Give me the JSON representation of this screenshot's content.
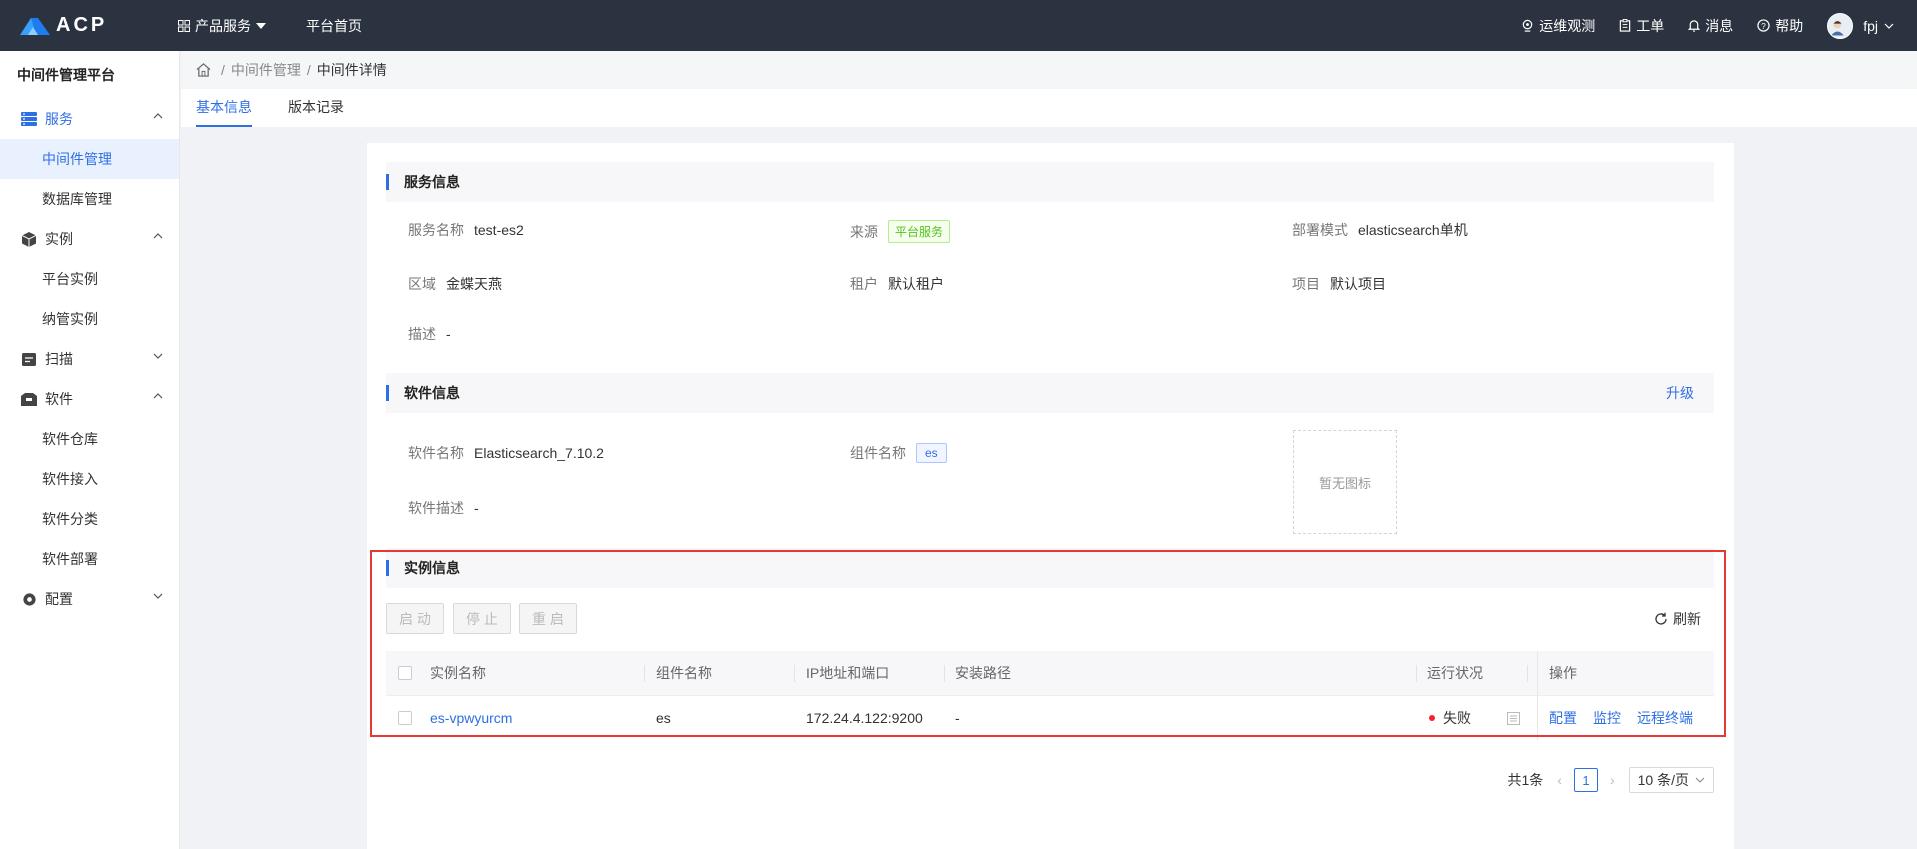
{
  "topbar": {
    "logo_text": "ACP",
    "nav": [
      "产品服务",
      "平台首页"
    ],
    "right": {
      "ops": "运维观测",
      "ticket": "工单",
      "messages": "消息",
      "help": "帮助",
      "user": "fpj"
    }
  },
  "sidebar": {
    "title": "中间件管理平台",
    "groups": [
      {
        "label": "服务",
        "items": [
          "中间件管理",
          "数据库管理"
        ]
      },
      {
        "label": "实例",
        "items": [
          "平台实例",
          "纳管实例"
        ]
      },
      {
        "label": "扫描",
        "items": []
      },
      {
        "label": "软件",
        "items": [
          "软件仓库",
          "软件接入",
          "软件分类",
          "软件部署"
        ]
      },
      {
        "label": "配置",
        "items": []
      }
    ]
  },
  "breadcrumb": {
    "sep": "/",
    "parent": "中间件管理",
    "current": "中间件详情"
  },
  "tabs": [
    "基本信息",
    "版本记录"
  ],
  "service_info": {
    "title": "服务信息",
    "name_label": "服务名称",
    "name": "test-es2",
    "source_label": "来源",
    "source": "平台服务",
    "deploy_label": "部署模式",
    "deploy": "elasticsearch单机",
    "region_label": "区域",
    "region": "金蝶天燕",
    "tenant_label": "租户",
    "tenant": "默认租户",
    "project_label": "项目",
    "project": "默认项目",
    "desc_label": "描述",
    "desc": "-"
  },
  "software_info": {
    "title": "软件信息",
    "upgrade": "升级",
    "name_label": "软件名称",
    "name": "Elasticsearch_7.10.2",
    "component_label": "组件名称",
    "component": "es",
    "desc_label": "软件描述",
    "desc": "-",
    "no_icon": "暂无图标"
  },
  "instance_info": {
    "title": "实例信息",
    "buttons": {
      "start": "启 动",
      "stop": "停 止",
      "restart": "重 启"
    },
    "refresh": "刷新",
    "columns": [
      "实例名称",
      "组件名称",
      "IP地址和端口",
      "安装路径",
      "运行状况",
      "操作"
    ],
    "rows": [
      {
        "name": "es-vpwyurcm",
        "component": "es",
        "ip": "172.24.4.122:9200",
        "path": "-",
        "status": "失败",
        "status_color": "#f5222d",
        "actions": [
          "配置",
          "监控",
          "远程终端"
        ]
      }
    ]
  },
  "pagination": {
    "total": "共1条",
    "page": "1",
    "size": "10 条/页"
  },
  "colors": {
    "primary": "#2f6fe4",
    "topbar": "#2b3340",
    "highlight": "#e53935"
  }
}
